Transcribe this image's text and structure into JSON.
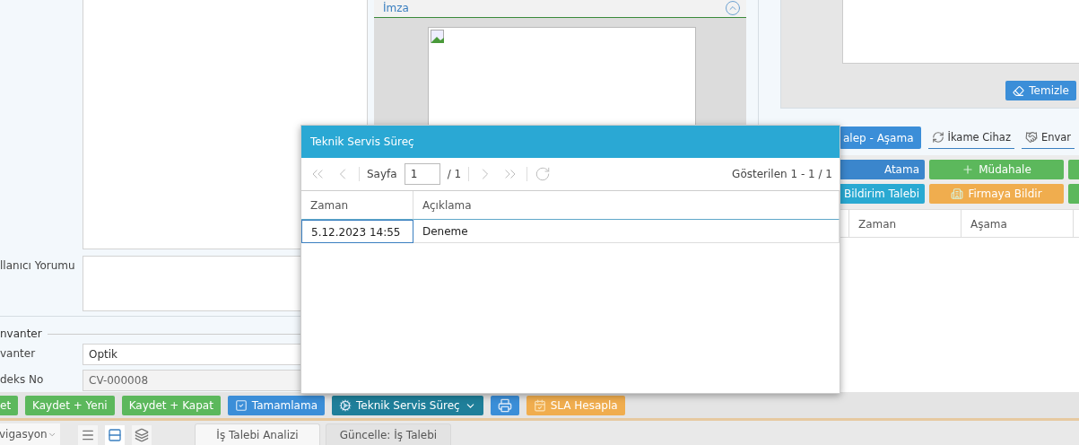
{
  "form": {
    "comment": {
      "label": "llanıcı Yorumu"
    },
    "inventory": {
      "legend": "nvanter",
      "fields": [
        {
          "label": "vanter",
          "value": "Optik",
          "readonly": false
        },
        {
          "label": "deks No",
          "value": "CV-000008",
          "readonly": true
        }
      ]
    }
  },
  "signature": {
    "title": "İmza",
    "expanded": true
  },
  "signature_pad": {
    "clear_button": "Temizle"
  },
  "process_toolbar": [
    {
      "label": "alep - Aşama",
      "kind": "button",
      "color": "#3b8ed8"
    },
    {
      "label": "İkame Cihaz",
      "kind": "link"
    },
    {
      "label": "Envar",
      "kind": "link"
    }
  ],
  "action_rows": [
    [
      {
        "label": "Atama",
        "color": "#3b86cc"
      },
      {
        "label": "Müdahale",
        "color": "#5cb85c"
      },
      {
        "color": "#5cb85c"
      }
    ],
    [
      {
        "label": "Bildirim Talebi",
        "color": "#29a9d2"
      },
      {
        "label": "Firmaya Bildir",
        "color": "#f0ad4e"
      },
      {
        "color": "#5cb85c"
      }
    ]
  ],
  "history_table": {
    "columns": [
      "Zaman",
      "Aşama"
    ]
  },
  "dialog": {
    "title": "Teknik Servis Süreç",
    "pager": {
      "page_label": "Sayfa",
      "page": "1",
      "total": "/ 1",
      "summary": "Gösterilen 1 - 1 / 1"
    },
    "columns": [
      "Zaman",
      "Açıklama"
    ],
    "rows": [
      {
        "cells": [
          "5.12.2023 14:55",
          "Deneme"
        ],
        "focused": true
      }
    ]
  },
  "action_bar": [
    {
      "label": "et",
      "color": "#5cb85c"
    },
    {
      "label": "Kaydet + Yeni",
      "color": "#5cb85c"
    },
    {
      "label": "Kaydet + Kapat",
      "color": "#5cb85c"
    },
    {
      "label": "Tamamlama",
      "color": "#3b8ed8"
    },
    {
      "label": "Teknik Servis Süreç",
      "dropdown": true,
      "color": "#1f7f9a"
    },
    {
      "color": "#3b8ed8"
    },
    {
      "label": "SLA Hesapla",
      "color": "#f0ad4e"
    }
  ],
  "nav": {
    "dropdown": "vigasyon",
    "views": [
      {
        "kind": "list",
        "selected": false
      },
      {
        "kind": "rows",
        "selected": true
      },
      {
        "kind": "windows",
        "selected": false
      }
    ],
    "tabs": [
      {
        "label": "İş Talebi Analizi",
        "selected": true
      },
      {
        "label": "Güncelle: İş Talebi",
        "selected": false
      }
    ]
  }
}
